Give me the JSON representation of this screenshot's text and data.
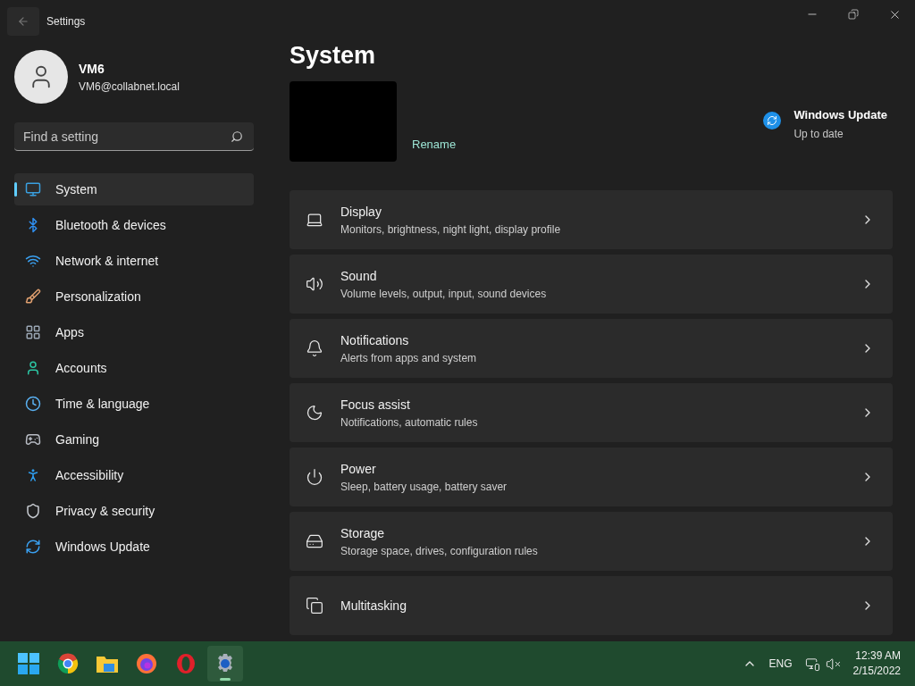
{
  "window": {
    "title": "Settings"
  },
  "account": {
    "name": "VM6",
    "email": "VM6@collabnet.local"
  },
  "search": {
    "placeholder": "Find a setting"
  },
  "nav": [
    {
      "label": "System",
      "kind": "system",
      "selected": true
    },
    {
      "label": "Bluetooth & devices",
      "kind": "bluetooth",
      "selected": false
    },
    {
      "label": "Network & internet",
      "kind": "network",
      "selected": false
    },
    {
      "label": "Personalization",
      "kind": "brush",
      "selected": false
    },
    {
      "label": "Apps",
      "kind": "apps",
      "selected": false
    },
    {
      "label": "Accounts",
      "kind": "accounts",
      "selected": false
    },
    {
      "label": "Time & language",
      "kind": "time",
      "selected": false
    },
    {
      "label": "Gaming",
      "kind": "gaming",
      "selected": false
    },
    {
      "label": "Accessibility",
      "kind": "accessibility",
      "selected": false
    },
    {
      "label": "Privacy & security",
      "kind": "privacy",
      "selected": false
    },
    {
      "label": "Windows Update",
      "kind": "update",
      "selected": false
    }
  ],
  "page": {
    "title": "System",
    "rename": "Rename",
    "update": {
      "title": "Windows Update",
      "status": "Up to date"
    }
  },
  "cards": [
    {
      "kind": "display",
      "title": "Display",
      "subtitle": "Monitors, brightness, night light, display profile"
    },
    {
      "kind": "sound",
      "title": "Sound",
      "subtitle": "Volume levels, output, input, sound devices"
    },
    {
      "kind": "notifications",
      "title": "Notifications",
      "subtitle": "Alerts from apps and system"
    },
    {
      "kind": "focus",
      "title": "Focus assist",
      "subtitle": "Notifications, automatic rules"
    },
    {
      "kind": "power",
      "title": "Power",
      "subtitle": "Sleep, battery usage, battery saver"
    },
    {
      "kind": "storage",
      "title": "Storage",
      "subtitle": "Storage space, drives, configuration rules"
    },
    {
      "kind": "multitasking",
      "title": "Multitasking"
    }
  ],
  "taskbar": {
    "apps": [
      {
        "kind": "start",
        "selected": false
      },
      {
        "kind": "chrome",
        "selected": false
      },
      {
        "kind": "explorer",
        "selected": false
      },
      {
        "kind": "firefox",
        "selected": false
      },
      {
        "kind": "opera",
        "selected": false
      },
      {
        "kind": "settings",
        "selected": true
      }
    ],
    "tray": {
      "language": "ENG",
      "time": "12:39 AM",
      "date": "2/15/2022"
    }
  }
}
